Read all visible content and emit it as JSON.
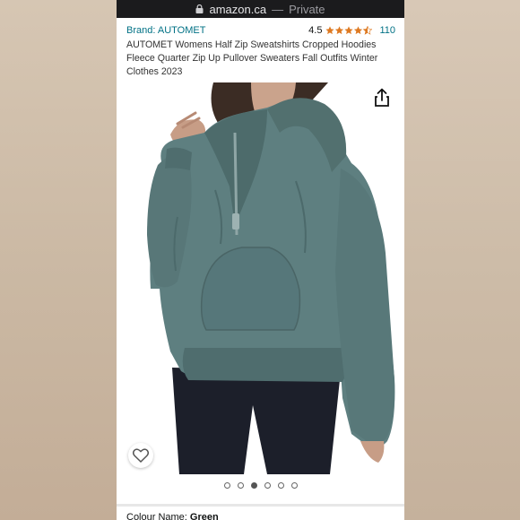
{
  "browser": {
    "domain": "amazon.ca",
    "separator": "—",
    "mode": "Private"
  },
  "product": {
    "brand": "Brand: AUTOMET",
    "rating": "4.5",
    "rating_count": "110",
    "stars": 4.5,
    "title": "AUTOMET Womens Half Zip Sweatshirts Cropped Hoodies Fleece Quarter Zip Up Pullover Sweaters Fall Outfits Winter Clothes 2023"
  },
  "gallery": {
    "total_images": 6,
    "active_index": 2
  },
  "colour": {
    "label": "Colour Name:",
    "value": "Green"
  },
  "colors": {
    "link": "#007185",
    "star": "#de7921",
    "sweatshirt": "#5e7f80",
    "leggings": "#1c1f2a"
  },
  "icons": [
    "lock-icon",
    "share-icon",
    "heart-icon",
    "star-icon"
  ]
}
